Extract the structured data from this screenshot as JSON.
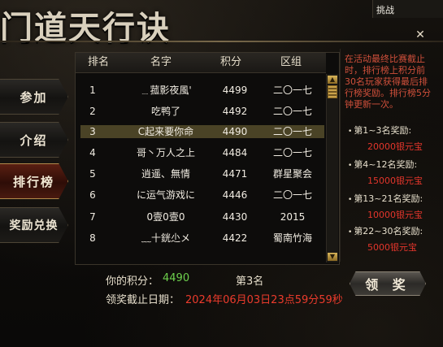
{
  "title": "门道天行诀",
  "top_notice": {
    "upper": "…",
    "lower": "挑战"
  },
  "nav": [
    {
      "label": "参加"
    },
    {
      "label": "介绍"
    },
    {
      "label": "排行榜",
      "active": true
    },
    {
      "label": "奖励兑换"
    }
  ],
  "table": {
    "headers": [
      "排名",
      "名字",
      "积分",
      "区组"
    ],
    "rows": [
      {
        "rank": "1",
        "name": "﹍菰影夜風'",
        "score": "4499",
        "group": "二〇一七"
      },
      {
        "rank": "2",
        "name": "吃鸭了",
        "score": "4492",
        "group": "二〇一七"
      },
      {
        "rank": "3",
        "name": "C起来要你命",
        "score": "4490",
        "group": "二〇一七",
        "highlight": true
      },
      {
        "rank": "4",
        "name": "哥丶万人之上",
        "score": "4484",
        "group": "二〇一七"
      },
      {
        "rank": "5",
        "name": "逍遥、無情",
        "score": "4471",
        "group": "群星聚会"
      },
      {
        "rank": "6",
        "name": "に运气游戏に",
        "score": "4446",
        "group": "二〇一七"
      },
      {
        "rank": "7",
        "name": "0壹0壹0",
        "score": "4430",
        "group": "2015"
      },
      {
        "rank": "8",
        "name": "﹏十銧尐メ",
        "score": "4422",
        "group": "蜀南竹海"
      }
    ]
  },
  "my_score": {
    "label": "你的积分：",
    "value": "4490",
    "rank": "第3名"
  },
  "deadline": {
    "label": "领奖截止日期：",
    "value": "2024年06月03日23点59分59秒"
  },
  "claim_button": "领 奖",
  "info_text": "在活动最终比赛截止时，排行榜上积分前30名玩家获得最后排行榜奖励。排行榜5分钟更新一次。",
  "rewards": [
    {
      "range": "第1~3名奖励:",
      "amount": "20000银元宝"
    },
    {
      "range": "第4~12名奖励:",
      "amount": "15000银元宝"
    },
    {
      "range": "第13~21名奖励:",
      "amount": "10000银元宝"
    },
    {
      "range": "第22~30名奖励:",
      "amount": "5000银元宝"
    }
  ],
  "close_icon": "close-icon",
  "colors": {
    "score_green": "#6ed14d",
    "red": "#ec3b2c",
    "highlight": "#4a4326"
  }
}
